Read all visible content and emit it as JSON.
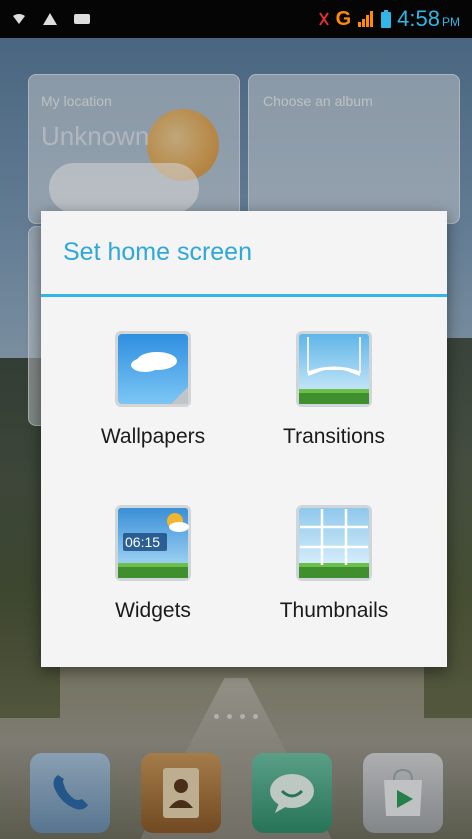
{
  "status_bar": {
    "network": "G",
    "time": "4:58",
    "ampm": "PM"
  },
  "background": {
    "weather_widget": {
      "location_label": "My location",
      "location_value": "Unknown"
    },
    "album_widget": {
      "label": "Choose an album"
    }
  },
  "dialog": {
    "title": "Set home screen",
    "options": [
      {
        "label": "Wallpapers",
        "icon": "wallpaper-icon"
      },
      {
        "label": "Transitions",
        "icon": "transitions-icon"
      },
      {
        "label": "Widgets",
        "icon": "widgets-icon"
      },
      {
        "label": "Thumbnails",
        "icon": "thumbnails-icon"
      }
    ],
    "widget_icon_time": "06:15"
  },
  "dock": {
    "items": [
      "phone-icon",
      "contacts-icon",
      "messaging-icon",
      "play-store-icon"
    ]
  },
  "colors": {
    "accent": "#33b5e5",
    "dialog_bg": "#f4f4f4",
    "status_bg": "#050505",
    "network_color": "#ff8c00"
  }
}
